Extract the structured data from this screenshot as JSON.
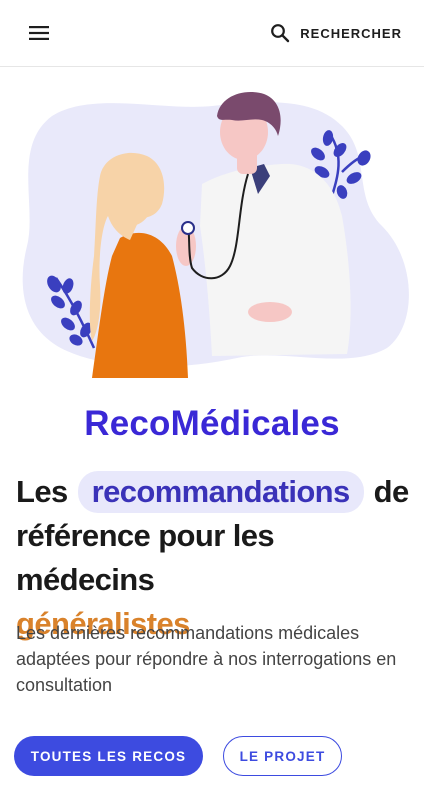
{
  "header": {
    "search_label": "RECHERCHER",
    "menu_icon": "hamburger-icon",
    "search_icon": "search-icon"
  },
  "hero": {
    "title": "RecoMédicales",
    "headline": {
      "part1": "Les",
      "highlight": "recommandations",
      "part2": "de",
      "part3": "référence pour les médecins",
      "accent": "généralistes"
    },
    "lead": "Les dernières recommandations médicales adaptées pour répondre à nos interrogations en consultation"
  },
  "buttons": {
    "primary": "TOUTES LES RECOS",
    "secondary": "LE PROJET"
  },
  "colors": {
    "brand": "#3a28d6",
    "highlight_bg": "#e8e8fb",
    "accent_orange": "#d9822b",
    "button_blue": "#3d4be0"
  }
}
